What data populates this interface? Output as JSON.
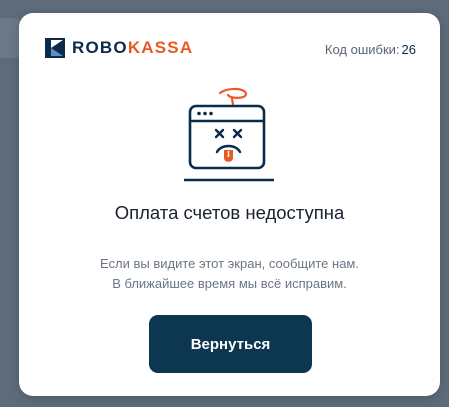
{
  "brand": {
    "name_part1": "ROBO",
    "name_part2": "KASSA",
    "logo_icon": "robokassa-k-mark-icon",
    "color_primary": "#0b2b4a",
    "color_accent": "#e85a24"
  },
  "error": {
    "code_label": "Код ошибки:",
    "code_value": "26"
  },
  "illustration": {
    "icon": "broken-browser-window-icon"
  },
  "content": {
    "title": "Оплата счетов недоступна",
    "message_line1": "Если вы видите этот экран, сообщите нам.",
    "message_line2": "В ближайшее время мы всё исправим."
  },
  "actions": {
    "back_label": "Вернуться",
    "back_color": "#0d3651"
  }
}
